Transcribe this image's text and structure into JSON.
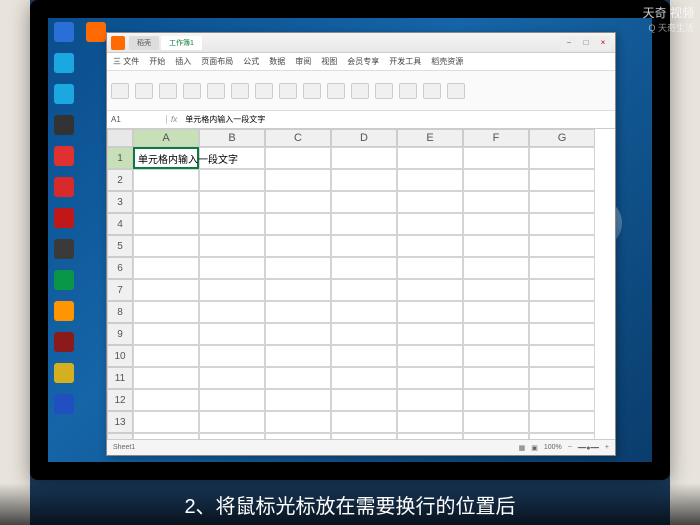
{
  "watermark": {
    "main": "天奇 视频",
    "sub": "Q 天奇生活"
  },
  "caption": "2、将鼠标光标放在需要换行的位置后",
  "desktop": {
    "icons": [
      {
        "c": "#2a6fd6"
      },
      {
        "c": "#1ba8e0"
      },
      {
        "c": "#1ba8e0"
      },
      {
        "c": "#333"
      },
      {
        "c": "#e03030"
      },
      {
        "c": "#d82a2a"
      },
      {
        "c": "#c01818"
      },
      {
        "c": "#3a3a3a"
      },
      {
        "c": "#0a9648"
      },
      {
        "c": "#ff9500"
      },
      {
        "c": "#8b1a1a"
      },
      {
        "c": "#d4b020"
      },
      {
        "c": "#2050c0"
      },
      {
        "c": "#ff6b00"
      }
    ]
  },
  "window": {
    "tabs": [
      {
        "label": "稻壳"
      },
      {
        "label": "工作簿1",
        "active": true
      }
    ],
    "menu": [
      "三 文件",
      "开始",
      "插入",
      "页面布局",
      "公式",
      "数据",
      "审阅",
      "视图",
      "会员专享",
      "开发工具",
      "稻壳资源"
    ],
    "formula": {
      "name": "A1",
      "hint": "单元格内输入一段文字"
    },
    "columns": [
      "A",
      "B",
      "C",
      "D",
      "E",
      "F",
      "G"
    ],
    "rows": 14,
    "cells": {
      "A1": "单元格内输入一段文字"
    },
    "activeCell": "A1",
    "status": {
      "sheet": "Sheet1",
      "zoom": "100%"
    }
  }
}
